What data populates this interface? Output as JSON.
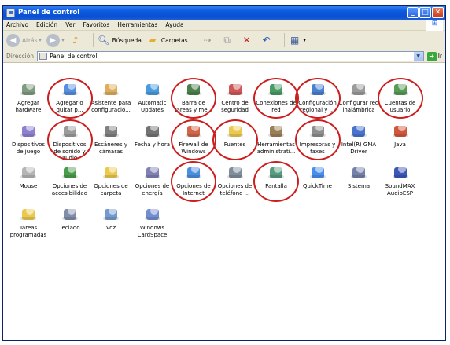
{
  "window": {
    "title": "Panel de control",
    "buttons": [
      "_",
      "□",
      "✕"
    ]
  },
  "menu": [
    "Archivo",
    "Edición",
    "Ver",
    "Favoritos",
    "Herramientas",
    "Ayuda"
  ],
  "toolbar": {
    "back": "Atrás",
    "search": "Búsqueda",
    "folders": "Carpetas"
  },
  "address": {
    "label": "Dirección",
    "value": "Panel de control",
    "go": "Ir"
  },
  "items": [
    {
      "label": "Agregar hardware",
      "icon": "hardware-icon",
      "color": "#6a8a6a"
    },
    {
      "label": "Agregar o quitar p...",
      "icon": "add-remove-programs-icon",
      "color": "#3a7ad8"
    },
    {
      "label": "Asistente para configuració...",
      "icon": "network-wizard-icon",
      "color": "#d8a040"
    },
    {
      "label": "Automatic Updates",
      "icon": "automatic-updates-icon",
      "color": "#2a8ad8"
    },
    {
      "label": "Barra de tareas y me...",
      "icon": "taskbar-icon",
      "color": "#2a6a2a"
    },
    {
      "label": "Centro de seguridad",
      "icon": "security-center-icon",
      "color": "#c83a3a"
    },
    {
      "label": "Conexiones de red",
      "icon": "network-connections-icon",
      "color": "#2a8a4a"
    },
    {
      "label": "Configuración regional y ...",
      "icon": "regional-settings-icon",
      "color": "#2a6ac8"
    },
    {
      "label": "Configurar red inalámbrica",
      "icon": "wireless-network-icon",
      "color": "#8a8a8a"
    },
    {
      "label": "Cuentas de usuario",
      "icon": "user-accounts-icon",
      "color": "#3a8a3a"
    },
    {
      "label": "Dispositivos de juego",
      "icon": "game-controller-icon",
      "color": "#7a6ac8"
    },
    {
      "label": "Dispositivos de sonido y audio",
      "icon": "speaker-icon",
      "color": "#8a8a8a"
    },
    {
      "label": "Escáneres y cámaras",
      "icon": "scanner-icon",
      "color": "#6a6a6a"
    },
    {
      "label": "Fecha y hora",
      "icon": "clock-icon",
      "color": "#5a5a5a"
    },
    {
      "label": "Firewall de Windows",
      "icon": "firewall-icon",
      "color": "#c84a2a"
    },
    {
      "label": "Fuentes",
      "icon": "fonts-folder-icon",
      "color": "#e8c030"
    },
    {
      "label": "Herramientas administrati...",
      "icon": "admin-tools-icon",
      "color": "#8a6a3a"
    },
    {
      "label": "Impresoras y faxes",
      "icon": "printer-icon",
      "color": "#7a7a7a"
    },
    {
      "label": "Intel(R) GMA Driver",
      "icon": "intel-gma-icon",
      "color": "#2a5ac8"
    },
    {
      "label": "Java",
      "icon": "java-icon",
      "color": "#c83a1a"
    },
    {
      "label": "Mouse",
      "icon": "mouse-icon",
      "color": "#a8a8a8"
    },
    {
      "label": "Opciones de accesibilidad",
      "icon": "accessibility-icon",
      "color": "#2a8a2a"
    },
    {
      "label": "Opciones de carpeta",
      "icon": "folder-options-icon",
      "color": "#e8c030"
    },
    {
      "label": "Opciones de energía",
      "icon": "power-options-icon",
      "color": "#6a6aa8"
    },
    {
      "label": "Opciones de Internet",
      "icon": "internet-options-icon",
      "color": "#2a7ad8"
    },
    {
      "label": "Opciones de teléfono ...",
      "icon": "phone-modem-icon",
      "color": "#6a7a8a"
    },
    {
      "label": "Pantalla",
      "icon": "display-icon",
      "color": "#3a8a6a"
    },
    {
      "label": "QuickTime",
      "icon": "quicktime-icon",
      "color": "#2a7ae8"
    },
    {
      "label": "Sistema",
      "icon": "system-icon",
      "color": "#5a6a9a"
    },
    {
      "label": "SoundMAX AudioESP",
      "icon": "soundmax-icon",
      "color": "#1a3aa8"
    },
    {
      "label": "Tareas programadas",
      "icon": "scheduled-tasks-icon",
      "color": "#e8c030"
    },
    {
      "label": "Teclado",
      "icon": "keyboard-icon",
      "color": "#6a7a9a"
    },
    {
      "label": "Voz",
      "icon": "speech-icon",
      "color": "#5a8ac8"
    },
    {
      "label": "Windows CardSpace",
      "icon": "cardspace-icon",
      "color": "#5a7ac8"
    }
  ]
}
